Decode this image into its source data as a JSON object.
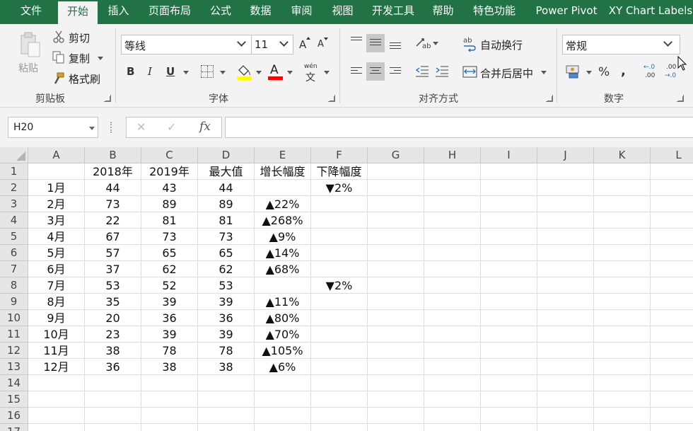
{
  "tabs": [
    "文件",
    "开始",
    "插入",
    "页面布局",
    "公式",
    "数据",
    "审阅",
    "视图",
    "开发工具",
    "帮助",
    "特色功能",
    "Power Pivot",
    "XY Chart Labels"
  ],
  "active_tab": "开始",
  "clipboard": {
    "paste_label": "粘贴",
    "cut_label": "剪切",
    "copy_label": "复制",
    "format_painter_label": "格式刷",
    "group_label": "剪贴板"
  },
  "font": {
    "font_name": "等线",
    "font_size": "11",
    "bold": "B",
    "italic": "I",
    "underline": "U",
    "font_color_glyph": "A",
    "phonetic_glyph": "wén",
    "phonetic_char": "文",
    "grow_glyph": "A",
    "shrink_glyph": "A",
    "group_label": "字体"
  },
  "alignment": {
    "wrap_text_label": "自动换行",
    "merge_center_label": "合并后居中",
    "group_label": "对齐方式"
  },
  "number": {
    "format": "常规",
    "percent_glyph": "%",
    "comma_glyph": ",",
    "increase_decimal": ".00",
    "decrease_decimal": ".00",
    "group_label": "数字"
  },
  "formula_bar": {
    "name_box": "H20",
    "cancel_glyph": "✕",
    "enter_glyph": "✓",
    "fx_label": "fx",
    "formula": ""
  },
  "columns": [
    "A",
    "B",
    "C",
    "D",
    "E",
    "F",
    "G",
    "H",
    "I",
    "J",
    "K",
    "L"
  ],
  "rows": [
    [
      "",
      "2018年",
      "2019年",
      "最大值",
      "增长幅度",
      "下降幅度"
    ],
    [
      "1月",
      "44",
      "43",
      "44",
      "",
      "▼2%"
    ],
    [
      "2月",
      "73",
      "89",
      "89",
      "▲22%",
      ""
    ],
    [
      "3月",
      "22",
      "81",
      "81",
      "▲268%",
      ""
    ],
    [
      "4月",
      "67",
      "73",
      "73",
      "▲9%",
      ""
    ],
    [
      "5月",
      "57",
      "65",
      "65",
      "▲14%",
      ""
    ],
    [
      "6月",
      "37",
      "62",
      "62",
      "▲68%",
      ""
    ],
    [
      "7月",
      "53",
      "52",
      "53",
      "",
      "▼2%"
    ],
    [
      "8月",
      "35",
      "39",
      "39",
      "▲11%",
      ""
    ],
    [
      "9月",
      "20",
      "36",
      "36",
      "▲80%",
      ""
    ],
    [
      "10月",
      "23",
      "39",
      "39",
      "▲70%",
      ""
    ],
    [
      "11月",
      "38",
      "78",
      "78",
      "▲105%",
      ""
    ],
    [
      "12月",
      "36",
      "38",
      "38",
      "▲6%",
      ""
    ],
    [
      "",
      "",
      "",
      "",
      "",
      ""
    ],
    [
      "",
      "",
      "",
      "",
      "",
      ""
    ],
    [
      "",
      "",
      "",
      "",
      "",
      ""
    ],
    [
      "",
      "",
      "",
      "",
      "",
      ""
    ]
  ],
  "colors": {
    "ribbon_green": "#217346",
    "highlight_yellow": "#ffff00",
    "font_red": "#ff0000"
  }
}
